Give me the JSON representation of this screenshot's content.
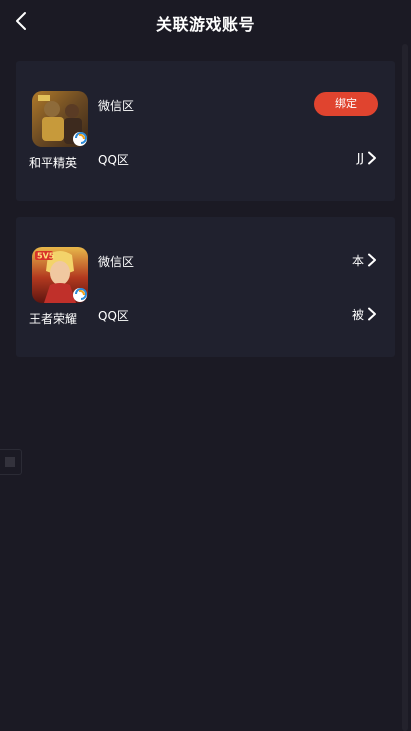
{
  "header": {
    "title": "关联游戏账号",
    "back_icon": "chevron-left-icon"
  },
  "colors": {
    "background": "#1b1a24",
    "card": "#20212e",
    "accent": "#e0442f"
  },
  "games": [
    {
      "name": "和平精英",
      "icon": "peace-elite-game-icon",
      "rows": [
        {
          "zone": "微信区",
          "action_label": "绑定"
        },
        {
          "zone": "QQ区",
          "value": "JJ"
        }
      ]
    },
    {
      "name": "王者荣耀",
      "icon": "honor-of-kings-game-icon",
      "rows": [
        {
          "zone": "微信区",
          "value": "本"
        },
        {
          "zone": "QQ区",
          "value": "被"
        }
      ]
    }
  ]
}
